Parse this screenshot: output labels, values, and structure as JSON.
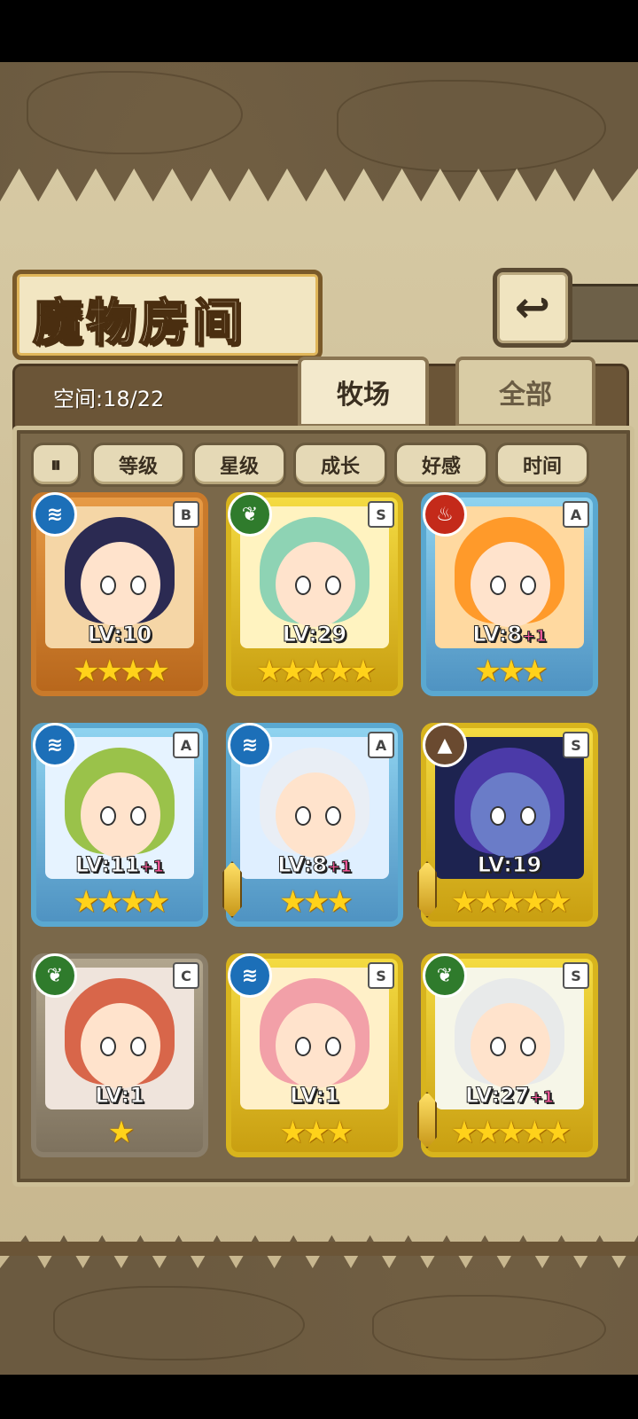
{
  "header": {
    "title": "魔物房间",
    "back_icon_label": "↩"
  },
  "tabs": {
    "space_label": "空间:18/22",
    "ranch": "牧场",
    "all": "全部"
  },
  "sort_buttons": {
    "toggle": "⏸",
    "level": "等级",
    "star": "星级",
    "growth": "成长",
    "affection": "好感",
    "time": "时间"
  },
  "monsters": [
    {
      "element": "water",
      "rank": "B",
      "lv": "LV:10",
      "bonus": "",
      "stars": 4,
      "star_text": "★★★★",
      "hair_color": "#2b2a52",
      "bg": "#f5d6a6",
      "sword": false
    },
    {
      "element": "grass",
      "rank": "S",
      "lv": "LV:29",
      "bonus": "",
      "stars": 5,
      "star_text": "★★★★★",
      "hair_color": "#8ed3b4",
      "bg": "#fff3c0",
      "sword": false
    },
    {
      "element": "fire",
      "rank": "A",
      "lv": "LV:8",
      "bonus": "+1",
      "stars": 3,
      "star_text": "★★★",
      "hair_color": "#ff9a2a",
      "bg": "#ffd9a0",
      "sword": false
    },
    {
      "element": "water",
      "rank": "A",
      "lv": "LV:11",
      "bonus": "+1",
      "stars": 4,
      "star_text": "★★★★",
      "hair_color": "#9ac24a",
      "bg": "#e6f3ff",
      "sword": false
    },
    {
      "element": "water",
      "rank": "A",
      "lv": "LV:8",
      "bonus": "+1",
      "stars": 3,
      "star_text": "★★★",
      "hair_color": "#e9eef5",
      "bg": "#dfefff",
      "sword": true
    },
    {
      "element": "earth",
      "rank": "S",
      "lv": "LV:19",
      "bonus": "",
      "stars": 5,
      "star_text": "★★★★★",
      "hair_color": "#4b3aa8",
      "bg": "#1d2350",
      "sword": true
    },
    {
      "element": "grass",
      "rank": "C",
      "lv": "LV:1",
      "bonus": "",
      "stars": 1,
      "star_text": "★",
      "hair_color": "#d8664a",
      "bg": "#efe4dc",
      "sword": false
    },
    {
      "element": "water",
      "rank": "S",
      "lv": "LV:1",
      "bonus": "",
      "stars": 3,
      "star_text": "★★★",
      "hair_color": "#f2a0a8",
      "bg": "#fff0c8",
      "sword": false
    },
    {
      "element": "grass",
      "rank": "S",
      "lv": "LV:27",
      "bonus": "+1",
      "stars": 5,
      "star_text": "★★★★★",
      "hair_color": "#e8eaea",
      "bg": "#f6f6e8",
      "sword": true
    }
  ],
  "element_icons": {
    "water": "≋",
    "grass": "❦",
    "fire": "♨",
    "earth": "▲"
  }
}
